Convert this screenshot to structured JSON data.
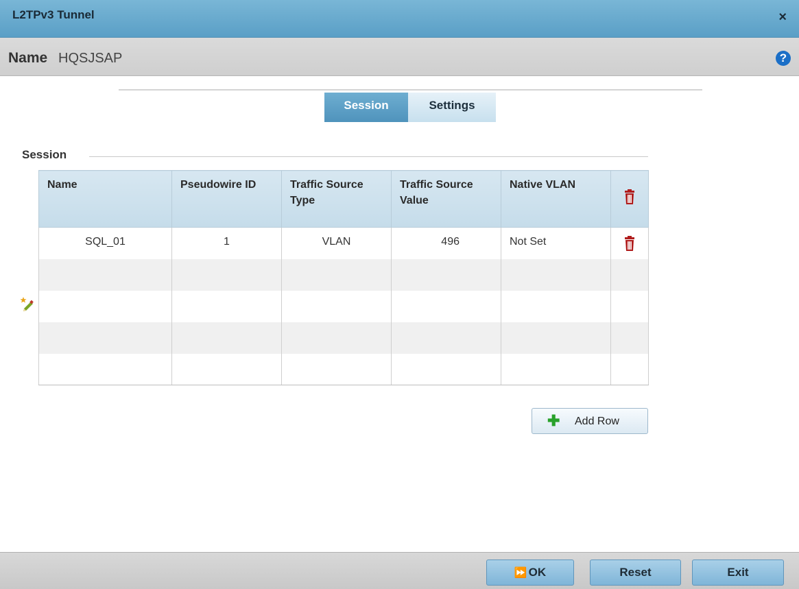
{
  "window": {
    "title": "L2TPv3 Tunnel",
    "close_symbol": "×"
  },
  "header": {
    "name_label": "Name",
    "name_value": "HQSJSAP",
    "help_symbol": "?"
  },
  "tabs": [
    {
      "label": "Session",
      "active": true
    },
    {
      "label": "Settings",
      "active": false
    }
  ],
  "section": {
    "title": "Session"
  },
  "table": {
    "columns": [
      "Name",
      "Pseudowire ID",
      "Traffic Source Type",
      "Traffic Source Value",
      "Native VLAN"
    ],
    "rows": [
      {
        "name": "SQL_01",
        "pseudowire_id": "1",
        "traffic_source_type": "VLAN",
        "traffic_source_value": "496",
        "native_vlan": "Not Set"
      }
    ]
  },
  "buttons": {
    "add_row": "Add Row",
    "ok": "OK",
    "reset": "Reset",
    "exit": "Exit"
  },
  "icons": {
    "delete": "trash-icon",
    "edit": "pencil-star-icon",
    "add": "plus-icon",
    "ok": "fast-forward-icon"
  },
  "colors": {
    "title_bar": "#5a9fc6",
    "tab_active": "#5b9dc4",
    "delete_icon": "#b01c1c",
    "add_icon": "#28a12a"
  }
}
